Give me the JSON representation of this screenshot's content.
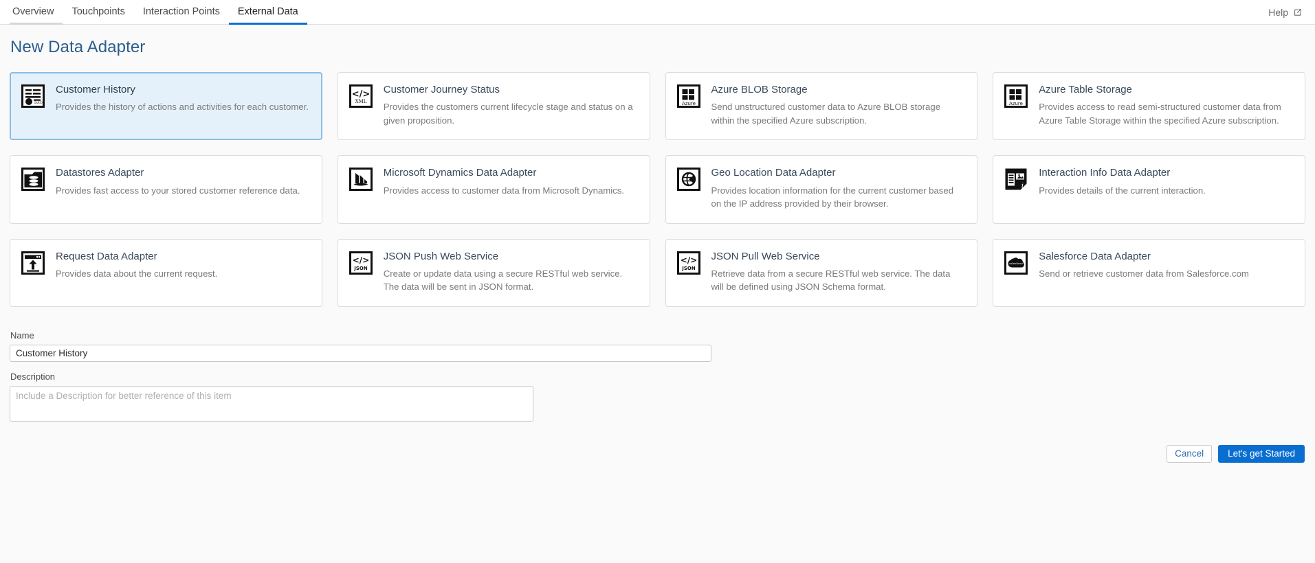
{
  "topbar": {
    "tabs": [
      {
        "label": "Overview",
        "state": "muted"
      },
      {
        "label": "Touchpoints",
        "state": "normal"
      },
      {
        "label": "Interaction Points",
        "state": "normal"
      },
      {
        "label": "External Data",
        "state": "active"
      }
    ],
    "help_label": "Help",
    "help_icon": "external-link-icon"
  },
  "page": {
    "title": "New Data Adapter"
  },
  "adapters": [
    {
      "id": "customer-history",
      "icon": "data-document-icon",
      "title": "Customer History",
      "description": "Provides the history of actions and activities for each customer.",
      "selected": true
    },
    {
      "id": "customer-journey-status",
      "icon": "xml-code-icon",
      "title": "Customer Journey Status",
      "description": "Provides the customers current lifecycle stage and status on a given proposition.",
      "selected": false
    },
    {
      "id": "azure-blob-storage",
      "icon": "azure-icon",
      "title": "Azure BLOB Storage",
      "description": "Send unstructured customer data to Azure BLOB storage within the specified Azure subscription.",
      "selected": false
    },
    {
      "id": "azure-table-storage",
      "icon": "azure-icon",
      "title": "Azure Table Storage",
      "description": "Provides access to read semi-structured customer data from Azure Table Storage within the specified Azure subscription.",
      "selected": false
    },
    {
      "id": "datastores-adapter",
      "icon": "database-icon",
      "title": "Datastores Adapter",
      "description": "Provides fast access to your stored customer reference data.",
      "selected": false
    },
    {
      "id": "microsoft-dynamics-data-adapter",
      "icon": "dynamics-icon",
      "title": "Microsoft Dynamics Data Adapter",
      "description": "Provides access to customer data from Microsoft Dynamics.",
      "selected": false
    },
    {
      "id": "geo-location-data-adapter",
      "icon": "globe-icon",
      "title": "Geo Location Data Adapter",
      "description": "Provides location information for the current customer based on the IP address provided by their browser.",
      "selected": false
    },
    {
      "id": "interaction-info-data-adapter",
      "icon": "interaction-info-icon",
      "title": "Interaction Info Data Adapter",
      "description": "Provides details of the current interaction.",
      "selected": false
    },
    {
      "id": "request-data-adapter",
      "icon": "request-window-icon",
      "title": "Request Data Adapter",
      "description": "Provides data about the current request.",
      "selected": false
    },
    {
      "id": "json-push-web-service",
      "icon": "json-code-icon",
      "title": "JSON Push Web Service",
      "description": "Create or update data using a secure RESTful web service. The data will be sent in JSON format.",
      "selected": false
    },
    {
      "id": "json-pull-web-service",
      "icon": "json-code-icon",
      "title": "JSON Pull Web Service",
      "description": "Retrieve data from a secure RESTful web service. The data will be defined using JSON Schema format.",
      "selected": false
    },
    {
      "id": "salesforce-data-adapter",
      "icon": "salesforce-icon",
      "title": "Salesforce Data Adapter",
      "description": "Send or retrieve customer data from Salesforce.com",
      "selected": false
    }
  ],
  "form": {
    "name_label": "Name",
    "name_value": "Customer History",
    "description_label": "Description",
    "description_value": "",
    "description_placeholder": "Include a Description for better reference of this item"
  },
  "footer": {
    "cancel_label": "Cancel",
    "submit_label": "Let's get Started"
  },
  "colors": {
    "accent": "#0a6ed1",
    "selected_card_bg": "#e4f1fb",
    "selected_card_border": "#8fbce0",
    "title": "#2b5d8c"
  }
}
